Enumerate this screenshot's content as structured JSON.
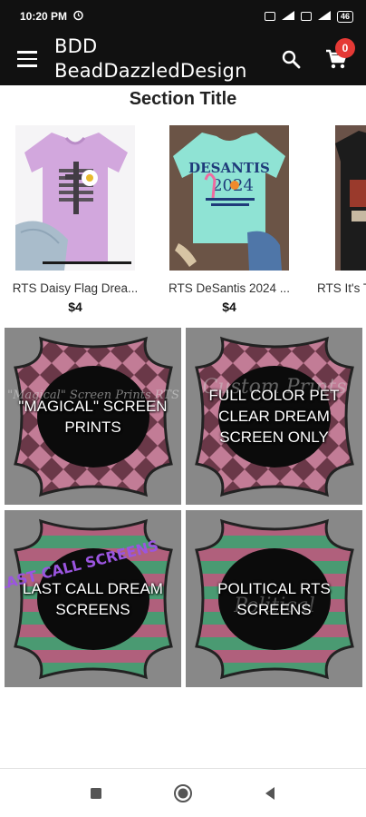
{
  "status_bar": {
    "time": "10:20 PM",
    "battery": "46"
  },
  "app_bar": {
    "brand_line1": "BDD",
    "brand_line2": "BeadDazzledDesign",
    "cart_count": "0",
    "search_icon": "search-icon",
    "cart_icon": "cart-icon",
    "menu_icon": "menu-icon"
  },
  "section": {
    "title": "Section Title"
  },
  "products": [
    {
      "name": "RTS Daisy Flag Drea...",
      "price": "$4"
    },
    {
      "name": "RTS DeSantis 2024 ...",
      "price": "$4"
    },
    {
      "name": "RTS It's T",
      "price": ""
    }
  ],
  "product_art": {
    "desantis_line1": "DESANTIS",
    "desantis_line2": "2024"
  },
  "categories": [
    {
      "label": "\"MAGICAL\" SCREEN PRINTS",
      "art_text": "\"Magical\" Screen Prints RTS"
    },
    {
      "label": "FULL COLOR PET CLEAR DREAM SCREEN ONLY",
      "art_text": "Custom Prints"
    },
    {
      "label": "LAST CALL DREAM SCREENS",
      "art_text": "LAST CALL SCREENS"
    },
    {
      "label": "POLITICAL RTS SCREENS",
      "art_text": "Political"
    }
  ],
  "colors": {
    "app_bar": "#111111",
    "badge": "#e53935",
    "tile_bg": "#888888",
    "glitter_pink": "#b0607c",
    "glitter_green": "#4a9a72"
  }
}
